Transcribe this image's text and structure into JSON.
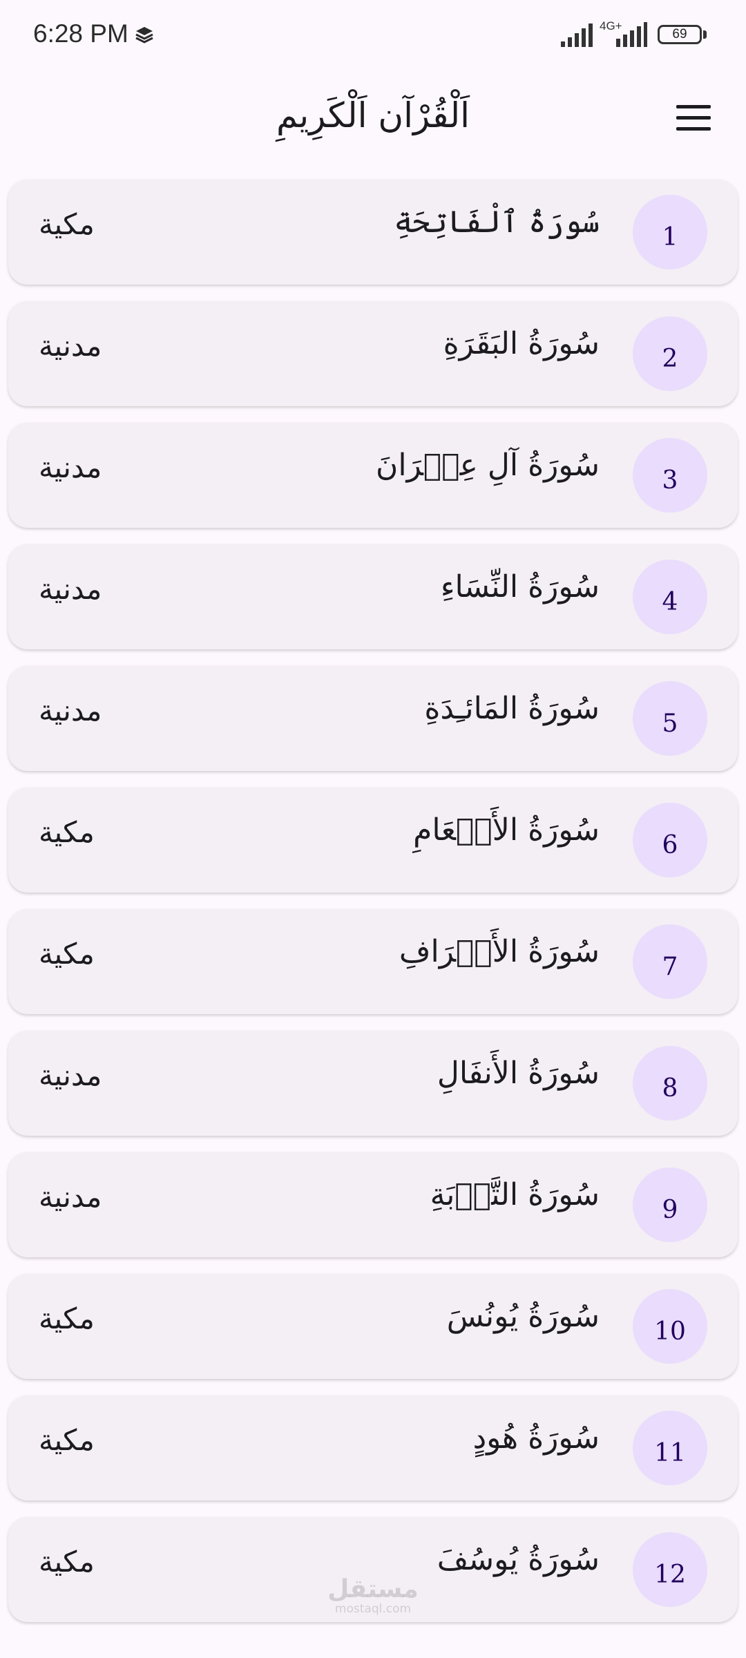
{
  "status_bar": {
    "time": "6:28 PM",
    "network": "4G+",
    "battery": "69"
  },
  "app_bar": {
    "title": "اَلْقُرْآن اَلْكَرِيمِ"
  },
  "surahs": [
    {
      "number": "1",
      "name": "سُورَةُ ٱلْفَاتِحَةِ",
      "type": "مكية"
    },
    {
      "number": "2",
      "name": "سُورَةُ البَقَرَةِ",
      "type": "مدنية"
    },
    {
      "number": "3",
      "name": "سُورَةُ آلِ عِمۡرَانَ",
      "type": "مدنية"
    },
    {
      "number": "4",
      "name": "سُورَةُ النِّسَاءِ",
      "type": "مدنية"
    },
    {
      "number": "5",
      "name": "سُورَةُ المَائـِدَةِ",
      "type": "مدنية"
    },
    {
      "number": "6",
      "name": "سُورَةُ الأَنۡعَامِ",
      "type": "مكية"
    },
    {
      "number": "7",
      "name": "سُورَةُ الأَعۡرَافِ",
      "type": "مكية"
    },
    {
      "number": "8",
      "name": "سُورَةُ الأَنفَالِ",
      "type": "مدنية"
    },
    {
      "number": "9",
      "name": "سُورَةُ التَّوۡبَةِ",
      "type": "مدنية"
    },
    {
      "number": "10",
      "name": "سُورَةُ يُونُسَ",
      "type": "مكية"
    },
    {
      "number": "11",
      "name": "سُورَةُ هُودٍ",
      "type": "مكية"
    },
    {
      "number": "12",
      "name": "سُورَةُ يُوسُفَ",
      "type": "مكية"
    }
  ],
  "watermark": {
    "arabic": "مستقل",
    "latin": "mostaql.com"
  },
  "colors": {
    "background": "#fdf8fd",
    "card": "#f4eff5",
    "number_circle": "#e9dcfc",
    "number_text": "#21005d"
  },
  "icons": {
    "menu": "hamburger-menu-icon",
    "layers": "layers-icon",
    "signal": "signal-bars-icon",
    "battery": "battery-icon"
  }
}
